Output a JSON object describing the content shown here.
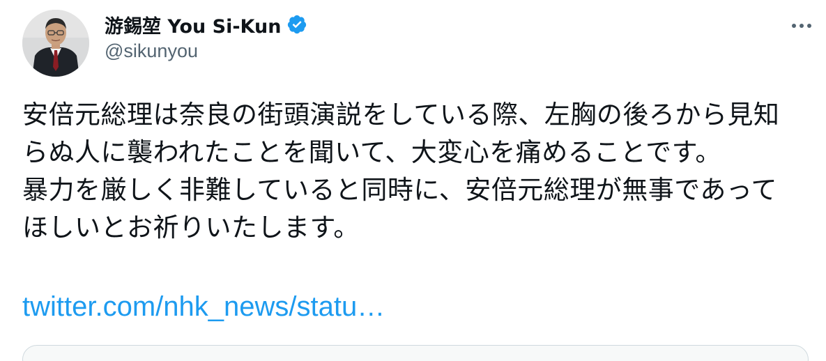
{
  "author": {
    "display_name": "游錫堃 You Si-Kun",
    "handle": "@sikunyou",
    "verified": true,
    "avatar_icon": "profile-photo"
  },
  "menu": {
    "more_icon": "more-horizontal-icon"
  },
  "tweet": {
    "paragraph_1": "安倍元総理は奈良の街頭演説をしている際、左胸の後ろから見知らぬ人に襲われたことを聞いて、大変心を痛めることです。",
    "paragraph_2": "暴力を厳しく非難していると同時に、安倍元総理が無事であってほしいとお祈りいたします。",
    "link_text": "twitter.com/nhk_news/statu…"
  },
  "colors": {
    "text": "#0f1419",
    "secondary": "#536471",
    "link": "#1d9bf0",
    "verified_badge": "#1d9bf0"
  }
}
